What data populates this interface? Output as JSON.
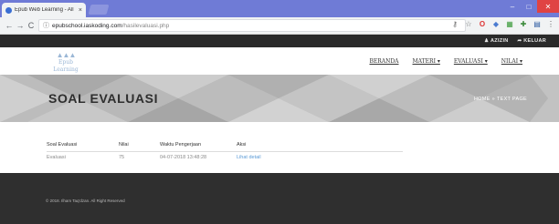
{
  "browser": {
    "tab_title": "Epub Web Learning - All",
    "tab_close": "×",
    "url_host": "epubschool.iaskoding.com",
    "url_path": "/hasilevaluasi.php",
    "nav_back": "←",
    "nav_forward": "→",
    "nav_reload": "C",
    "min": "–",
    "max": "□",
    "close": "✕"
  },
  "topbar": {
    "user_label": "♟ AZIZIN",
    "logout_label": "➦ KELUAR"
  },
  "header": {
    "logo_text": "Epub Learning",
    "menu": [
      {
        "label": "BERANDA"
      },
      {
        "label": "MATERI ▾"
      },
      {
        "label": "EVALUASI ▾"
      },
      {
        "label": "NILAI ▾"
      }
    ]
  },
  "banner": {
    "title": "SOAL EVALUASI",
    "crumb_home": "HOME",
    "crumb_sep": "»",
    "crumb_current": "TEXT PAGE"
  },
  "table": {
    "headers": [
      "Soal Evaluasi",
      "Nilai",
      "Waktu Pengerjaan",
      "Aksi"
    ],
    "rows": [
      {
        "soal": "Evaluasi",
        "nilai": "75",
        "waktu": "04-07-2018 13:48:28",
        "aksi": "Lihat detail"
      }
    ]
  },
  "footer": {
    "copyright": "© 2018. Ilham Taq'dzan. All Right Reserved"
  },
  "colors": {
    "chrome": "#6f7bd6",
    "topbar": "#2a2a2a",
    "banner": "#bcbcbc",
    "footer": "#2f2f2f",
    "link": "#5c9bd6"
  }
}
